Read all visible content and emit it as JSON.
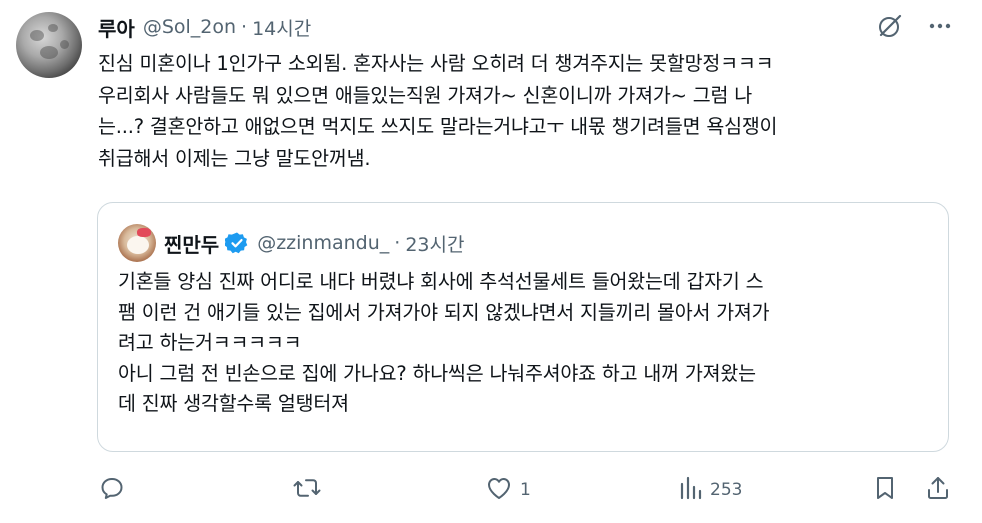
{
  "post": {
    "display_name": "루아",
    "handle": "@Sol_2on",
    "separator": "·",
    "time": "14시간",
    "text": "진심 미혼이나 1인가구 소외됨. 혼자사는 사람 오히려 더 챙겨주지는 못할망정ㅋㅋㅋ\n우리회사 사람들도 뭐 있으면 애들있는직원 가져가~ 신혼이니까 가져가~ 그럼 나\n는...? 결혼안하고 애없으면 먹지도 쓰지도 말라는거냐고ㅜ 내몫 챙기려들면 욕심쟁이\n취급해서 이제는 그냥 말도안꺼냄."
  },
  "quote": {
    "display_name": "찐만두",
    "handle": "@zzinmandu_",
    "separator": "·",
    "time": "23시간",
    "text": "기혼들 양심 진짜 어디로 내다 버렸냐 회사에 추석선물세트 들어왔는데 갑자기 스\n팸 이런 건 애기들 있는 집에서 가져가야 되지 않겠냐면서 지들끼리 몰아서 가져가\n려고 하는거ㅋㅋㅋㅋㅋ\n아니 그럼 전 빈손으로 집에 가나요? 하나씩은 나눠주셔야죠 하고 내꺼 가져왔는\n데 진짜 생각할수록 얼탱터져"
  },
  "actions": {
    "reply_count": "",
    "repost_count": "",
    "like_count": "1",
    "views_count": "253"
  },
  "icons": {
    "top": [
      "grok-icon",
      "more-icon"
    ],
    "actions": [
      "reply-icon",
      "repost-icon",
      "like-icon",
      "views-icon",
      "bookmark-icon",
      "share-icon"
    ]
  },
  "colors": {
    "text": "#0f1419",
    "secondary": "#536471",
    "border": "#cfd9de",
    "verified": "#1d9bf0"
  }
}
